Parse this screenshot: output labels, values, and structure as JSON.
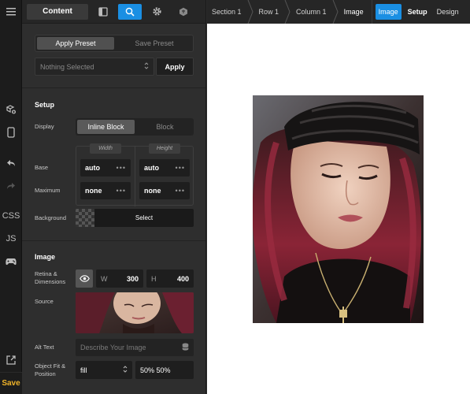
{
  "rail": {
    "css_label": "CSS",
    "js_label": "JS",
    "save_label": "Save"
  },
  "panel": {
    "tab_content": "Content",
    "presets": {
      "apply": "Apply Preset",
      "save": "Save Preset"
    },
    "preset_select": {
      "value": "Nothing Selected",
      "apply": "Apply"
    },
    "setup": {
      "title": "Setup",
      "display_label": "Display",
      "display_options": [
        "Inline Block",
        "Block"
      ],
      "display_selected": "Inline Block",
      "width_label": "Width",
      "height_label": "Height",
      "base_label": "Base",
      "maximum_label": "Maximum",
      "base_width": "auto",
      "base_height": "auto",
      "max_width": "none",
      "max_height": "none",
      "dots": "•••",
      "background_label": "Background",
      "background_select": "Select"
    },
    "image": {
      "title": "Image",
      "retina_label_1": "Retina &",
      "retina_label_2": "Dimensions",
      "w_key": "W",
      "w_value": "300",
      "h_key": "H",
      "h_value": "400",
      "source_label": "Source",
      "alt_label": "Alt Text",
      "alt_placeholder": "Describe Your Image",
      "fit_label_1": "Object Fit &",
      "fit_label_2": "Position",
      "fit_value": "fill",
      "position_value": "50% 50%"
    }
  },
  "breadcrumb": [
    "Section 1",
    "Row 1",
    "Column 1",
    "Image"
  ],
  "modes": [
    "Image",
    "Setup",
    "Design"
  ],
  "colors": {
    "accent": "#1a8fe3",
    "save": "#f0b429"
  }
}
